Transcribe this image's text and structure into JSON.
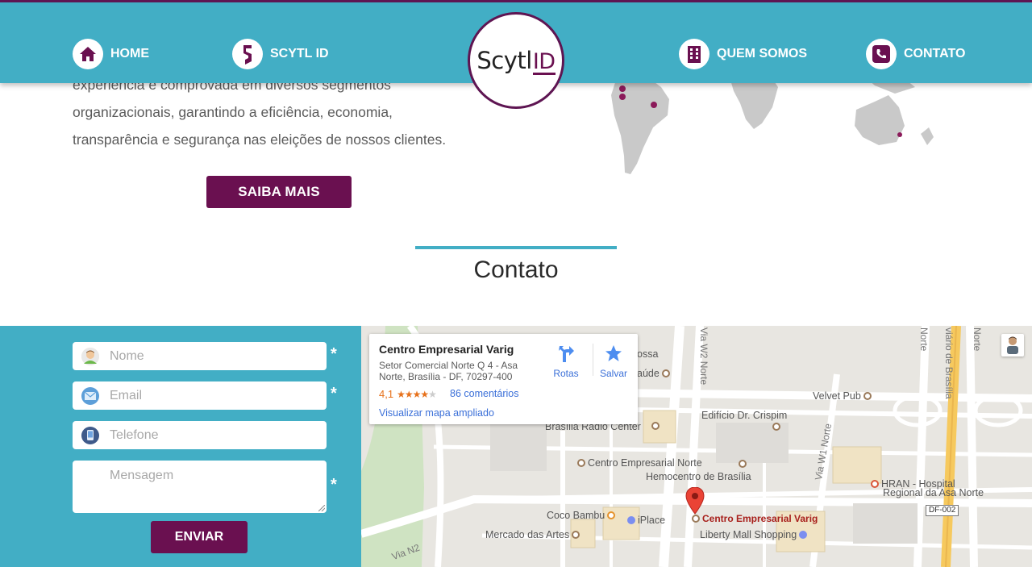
{
  "colors": {
    "teal": "#42aec5",
    "purple": "#6a1050",
    "header_border": "#5e1552",
    "text_grey": "#5b5b5b"
  },
  "nav": {
    "items": [
      {
        "label": "HOME",
        "icon": "home-icon"
      },
      {
        "label": "SCYTL ID",
        "icon": "scytl-s-icon"
      },
      {
        "label": "QUEM SOMOS",
        "icon": "building-icon"
      },
      {
        "label": "CONTATO",
        "icon": "phone-icon"
      }
    ],
    "logo": {
      "main": "Scytl",
      "suffix": "ID"
    }
  },
  "about": {
    "lines": [
      "experiência e comprovada em diversos segmentos",
      "organizacionais, garantindo a eficiência, economia,",
      "transparência e segurança nas eleições de nossos clientes."
    ],
    "button": "SAIBA MAIS"
  },
  "contact": {
    "title": "Contato",
    "form": {
      "name_placeholder": "Nome",
      "email_placeholder": "Email",
      "phone_placeholder": "Telefone",
      "message_placeholder": "Mensagem",
      "required_mark": "*",
      "submit": "ENVIAR"
    }
  },
  "map": {
    "infobox": {
      "title": "Centro Empresarial Varig",
      "address": "Setor Comercial Norte Q 4 - Asa Norte, Brasília - DF, 70297-400",
      "rating": "4,1",
      "stars": "★★★★",
      "half_star": "★",
      "reviews": "86 comentários",
      "link": "Visualizar mapa ampliado",
      "directions": "Rotas",
      "save": "Salvar"
    },
    "pois": {
      "varig": "Centro Empresarial Varig",
      "velvet": "Velvet Pub",
      "crispim": "Edifício Dr. Crispim",
      "radio": "Brasília Rádio Center",
      "norte": "Centro Empresarial Norte",
      "hemocentro": "Hemocentro de Brasília",
      "hran": "HRAN - Hospital",
      "hran2": "Regional da Asa Norte",
      "coco": "Coco Bambu",
      "iplace": "iPlace",
      "mercado": "Mercado das Artes",
      "liberty": "Liberty Mall Shopping",
      "partial1": "ossa",
      "partial2": "aúde"
    },
    "streets": {
      "w2": "Via W2 Norte",
      "w1": "Via W1 Norte",
      "n2": "Via N2",
      "eixo": "viário de Brasília",
      "norte1": "Norte",
      "norte2": "Norte",
      "route": "DF-002"
    }
  }
}
